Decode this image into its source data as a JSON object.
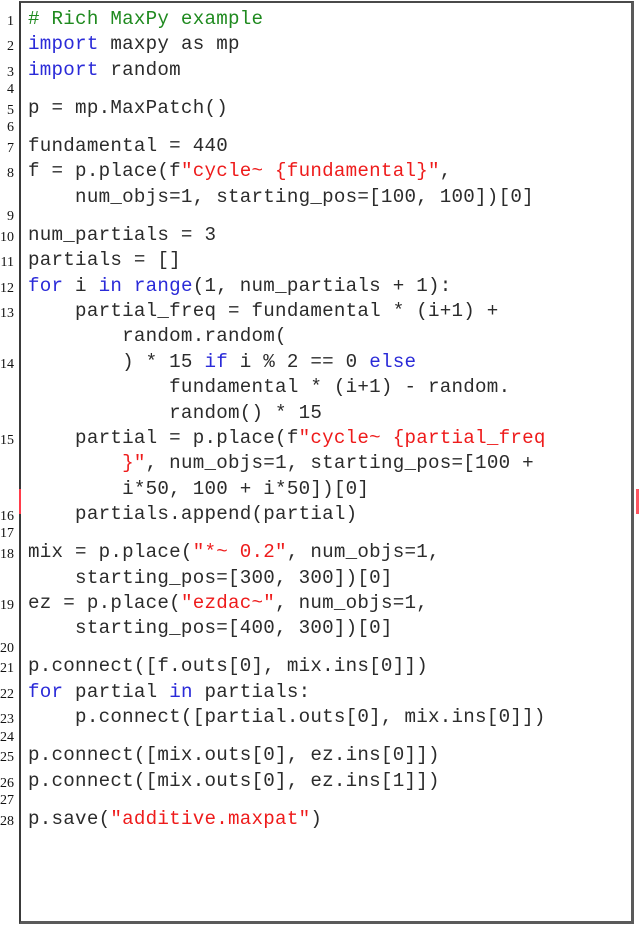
{
  "document": {
    "title": "Rich MaxPy example",
    "language": "python",
    "colors": {
      "keyword": "#2a2ad8",
      "string": "#ee1b1b",
      "comment": "#1f8a1f",
      "text": "#2b2b2b",
      "frame": "#4a4a4a",
      "change_marker": "#ff3b4a"
    },
    "lines": [
      {
        "n": "1",
        "rows": [
          [
            [
              "cm",
              "# Rich MaxPy example"
            ]
          ]
        ]
      },
      {
        "n": "2",
        "rows": [
          [
            [
              "kw",
              "import"
            ],
            [
              "",
              " maxpy as mp"
            ]
          ]
        ]
      },
      {
        "n": "3",
        "rows": [
          [
            [
              "kw",
              "import"
            ],
            [
              "",
              " random"
            ]
          ]
        ]
      },
      {
        "n": "4",
        "rows": [
          []
        ]
      },
      {
        "n": "5",
        "rows": [
          [
            [
              "",
              "p = mp.MaxPatch()"
            ]
          ]
        ]
      },
      {
        "n": "6",
        "rows": [
          []
        ]
      },
      {
        "n": "7",
        "rows": [
          [
            [
              "",
              "fundamental = 440"
            ]
          ]
        ]
      },
      {
        "n": "8",
        "rows": [
          [
            [
              "",
              "f = p.place(f"
            ],
            [
              "str",
              "\"cycle~ {fundamental}\""
            ],
            [
              "",
              ","
            ]
          ],
          [
            [
              "",
              "    num_objs=1, starting_pos=[100, 100])[0]"
            ]
          ]
        ]
      },
      {
        "n": "9",
        "rows": [
          []
        ]
      },
      {
        "n": "10",
        "rows": [
          [
            [
              "",
              "num_partials = 3"
            ]
          ]
        ]
      },
      {
        "n": "11",
        "rows": [
          [
            [
              "",
              "partials = []"
            ]
          ]
        ]
      },
      {
        "n": "12",
        "rows": [
          [
            [
              "kw",
              "for"
            ],
            [
              "",
              " i "
            ],
            [
              "kw",
              "in"
            ],
            [
              "",
              " "
            ],
            [
              "kw",
              "range"
            ],
            [
              "",
              "(1, num_partials + 1):"
            ]
          ]
        ]
      },
      {
        "n": "13",
        "rows": [
          [
            [
              "",
              "    partial_freq = fundamental * (i+1) +"
            ]
          ],
          [
            [
              "",
              "        random.random("
            ]
          ]
        ]
      },
      {
        "n": "14",
        "rows": [
          [
            [
              "",
              "        ) * 15 "
            ],
            [
              "kw",
              "if"
            ],
            [
              "",
              " i % 2 == 0 "
            ],
            [
              "kw",
              "else"
            ]
          ],
          [
            [
              "",
              "            fundamental * (i+1) - random."
            ]
          ],
          [
            [
              "",
              "            random() * 15"
            ]
          ]
        ]
      },
      {
        "n": "15",
        "rows": [
          [
            [
              "",
              "    partial = p.place(f"
            ],
            [
              "str",
              "\"cycle~ {partial_freq"
            ]
          ],
          [
            [
              "str",
              "        }\""
            ],
            [
              "",
              ", num_objs=1, starting_pos=[100 +"
            ]
          ],
          [
            [
              "",
              "        i*50, 100 + i*50])[0]"
            ]
          ]
        ]
      },
      {
        "n": "16",
        "rows": [
          [
            [
              "",
              "    partials.append(partial)"
            ]
          ]
        ]
      },
      {
        "n": "17",
        "rows": [
          []
        ]
      },
      {
        "n": "18",
        "rows": [
          [
            [
              "",
              "mix = p.place("
            ],
            [
              "str",
              "\"*~ 0.2\""
            ],
            [
              "",
              ", num_objs=1,"
            ]
          ],
          [
            [
              "",
              "    starting_pos=[300, 300])[0]"
            ]
          ]
        ]
      },
      {
        "n": "19",
        "rows": [
          [
            [
              "",
              "ez = p.place("
            ],
            [
              "str",
              "\"ezdac~\""
            ],
            [
              "",
              ", num_objs=1,"
            ]
          ],
          [
            [
              "",
              "    starting_pos=[400, 300])[0]"
            ]
          ]
        ]
      },
      {
        "n": "20",
        "rows": [
          []
        ]
      },
      {
        "n": "21",
        "rows": [
          [
            [
              "",
              "p.connect([f.outs[0], mix.ins[0]])"
            ]
          ]
        ]
      },
      {
        "n": "22",
        "rows": [
          [
            [
              "kw",
              "for"
            ],
            [
              "",
              " partial "
            ],
            [
              "kw",
              "in"
            ],
            [
              "",
              " partials:"
            ]
          ]
        ]
      },
      {
        "n": "23",
        "rows": [
          [
            [
              "",
              "    p.connect([partial.outs[0], mix.ins[0]])"
            ]
          ]
        ]
      },
      {
        "n": "24",
        "rows": [
          []
        ]
      },
      {
        "n": "25",
        "rows": [
          [
            [
              "",
              "p.connect([mix.outs[0], ez.ins[0]])"
            ]
          ]
        ]
      },
      {
        "n": "26",
        "rows": [
          [
            [
              "",
              "p.connect([mix.outs[0], ez.ins[1]])"
            ]
          ]
        ]
      },
      {
        "n": "27",
        "rows": [
          []
        ]
      },
      {
        "n": "28",
        "rows": [
          [
            [
              "",
              "p.save("
            ],
            [
              "str",
              "\"additive.maxpat\""
            ],
            [
              "",
              ")"
            ]
          ]
        ]
      }
    ]
  }
}
